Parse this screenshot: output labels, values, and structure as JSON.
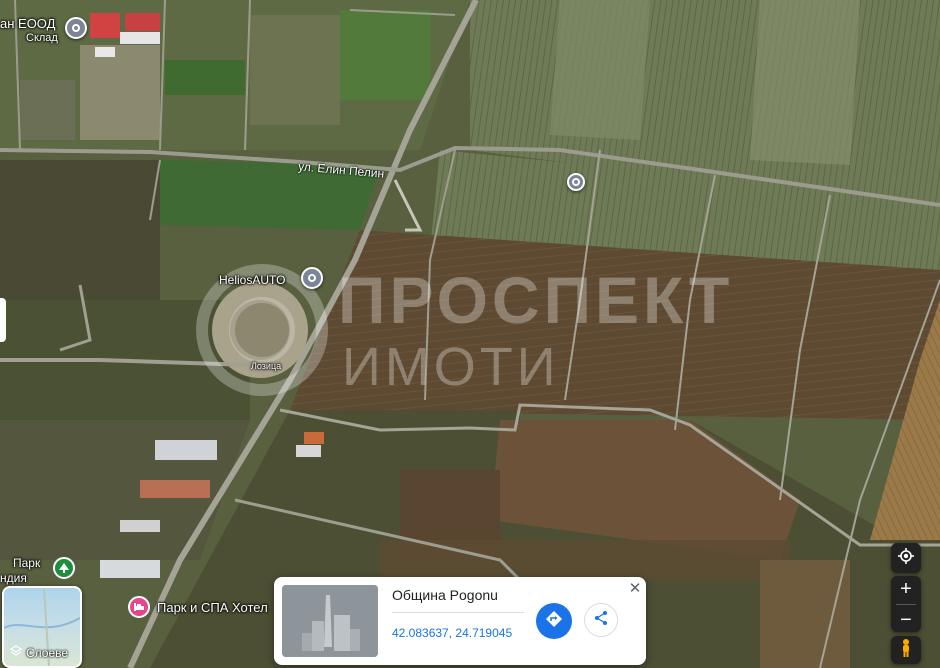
{
  "labels": {
    "company_top": "ан ЕООД",
    "company_sub": "Склад",
    "street": "ул. Елин Пелин",
    "helios": "HeliosAUTO",
    "small_place": "Лозица",
    "park_short": "Парк",
    "park_short2": "ндия",
    "park_spa": "Парк и СПА Хотел"
  },
  "watermark": {
    "line1": "ПРОСПЕКТ",
    "line2": "ИМОТИ"
  },
  "controls": {
    "zoom_in": "+",
    "zoom_out": "−",
    "layers_label": "Слоеве"
  },
  "card": {
    "title": "Община Pogonu",
    "coords": "42.083637, 24.719045",
    "close": "✕"
  },
  "icons": {
    "pin": "location-pin-icon",
    "directions": "directions-icon",
    "share": "share-icon",
    "locate": "my-location-icon",
    "pegman": "pegman-icon",
    "layers": "layers-icon",
    "park": "tree-icon",
    "hotel": "bed-icon"
  },
  "colors": {
    "accent": "#1a73e8",
    "pin": "#7c8596",
    "park_pin": "#1e8e3e",
    "hotel_pin": "#e8448c",
    "pegman": "#f9ab00"
  }
}
